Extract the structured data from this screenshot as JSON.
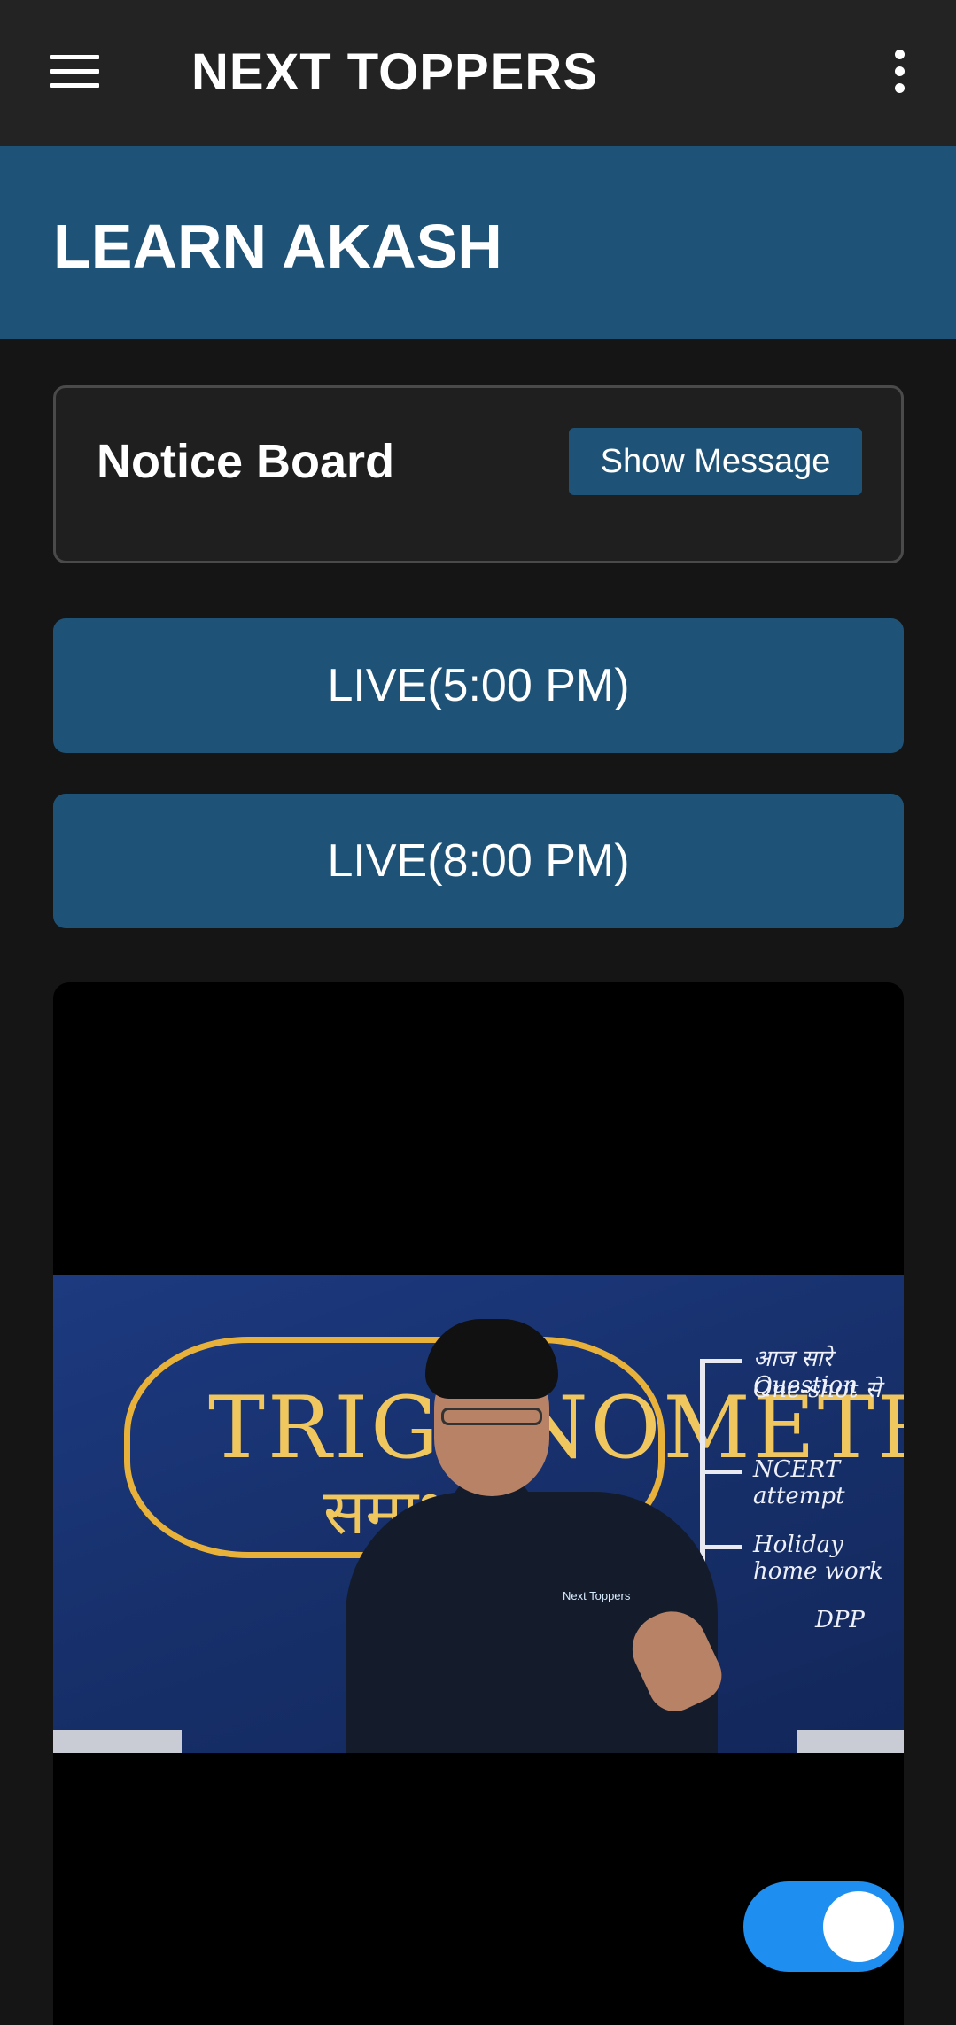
{
  "toolbar": {
    "menu_icon": "hamburger-menu-icon",
    "title": "NEXT TOPPERS",
    "overflow_icon": "more-vertical-icon"
  },
  "banner": {
    "title": "LEARN AKASH"
  },
  "notice_board": {
    "title": "Notice Board",
    "button_label": "Show Message"
  },
  "live_buttons": [
    {
      "label": "LIVE(5:00 PM)"
    },
    {
      "label": "LIVE(8:00 PM)"
    }
  ],
  "video": {
    "board_text_line1": "TRIGONOMETRY",
    "board_text_line2": "समाधान",
    "board_notes": [
      "आज सारे Question",
      "One-shot से",
      "NCERT attempt",
      "Holiday home work",
      "DPP"
    ],
    "shirt_logo": "Next Toppers"
  },
  "toggle": {
    "state": "on"
  },
  "colors": {
    "toolbar_bg": "#232323",
    "accent": "#1e5377",
    "background": "#151515",
    "toggle_on": "#1e8ef0"
  }
}
